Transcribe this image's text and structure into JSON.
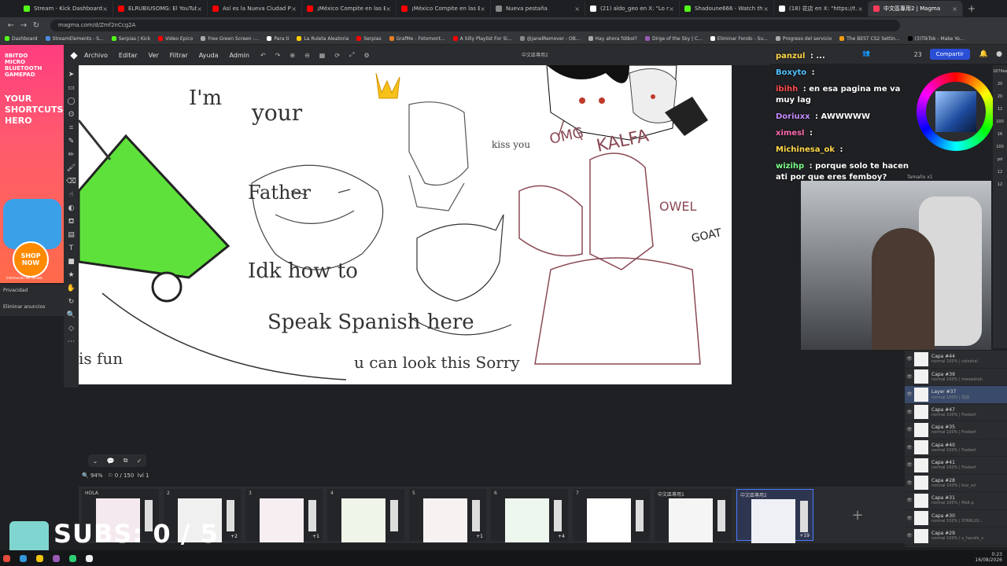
{
  "browser": {
    "tabs": [
      {
        "title": "Stream - Kick Dashboard",
        "color": "#53fc18"
      },
      {
        "title": "ELRUBIUSOMG: El YouTuber C",
        "color": "#ff0000"
      },
      {
        "title": "Así es la Nueva Ciudad Privad",
        "color": "#ff0000"
      },
      {
        "title": "¡México Compite en las Escon",
        "color": "#ff0000"
      },
      {
        "title": "¡México Compite en las Escon",
        "color": "#ff0000"
      },
      {
        "title": "Nueva pestaña",
        "color": "#888888"
      },
      {
        "title": "(21) aldo_geo en X: \"Lo recon",
        "color": "#ffffff"
      },
      {
        "title": "Shadoune666 - Watch the VO",
        "color": "#53fc18"
      },
      {
        "title": "(18) 花店 en X: \"https://t.co",
        "color": "#ffffff"
      },
      {
        "title": "中文區專用2 | Magma",
        "color": "#ff3b5c",
        "active": true
      }
    ],
    "url": "magma.com/d/Zmf2nCcg2A",
    "bookmarks": [
      "Dashboard",
      "StreamElements - S...",
      "Serpias | Kick",
      "Video Epico",
      "Free Green Screen -...",
      "Para ti",
      "La Ruleta Aleatoria",
      "Serpias",
      "GrafMe - Fotomont...",
      "A Silly Playlist For Si...",
      "@janelRemover - OB...",
      "Hay ahora fútbol?",
      "Dirge of the Sky | C...",
      "Eliminar Fondo - Su...",
      "Progreso del servicio",
      "The BEST CS2 Settin...",
      "(3)TikTok - Make Yo..."
    ]
  },
  "ad": {
    "line1": "8BITDO\nMICRO\nBLUETOOTH\nGAMEPAD",
    "line2": "YOUR\nSHORTCUTS\nHERO",
    "shop": "SHOP\nNOW",
    "info": "Información de afiliado"
  },
  "privacy": {
    "title": "Privacidad",
    "remove": "Eliminar anuncios"
  },
  "app": {
    "menus": [
      "Archivo",
      "Editar",
      "Ver",
      "Filtrar",
      "Ayuda",
      "Admin"
    ],
    "doc_title": "中文區專用2",
    "share": "Compartir",
    "online_count": "23",
    "zoom": "94%",
    "page_info": "0 / 150",
    "level": "lvl 1"
  },
  "canvas_text": [
    "I'm",
    "your",
    "Father",
    "Idk how to",
    "Speak Spanish here",
    "u can look this Sorry",
    "is fun",
    "kiss you",
    "OMG",
    "KALFA",
    "OWEL",
    "GOAT"
  ],
  "pages": [
    {
      "label": "HOLA",
      "badge": ""
    },
    {
      "label": "2",
      "badge": "+2"
    },
    {
      "label": "3",
      "badge": "+1"
    },
    {
      "label": "4",
      "badge": ""
    },
    {
      "label": "5",
      "badge": "+1"
    },
    {
      "label": "6",
      "badge": "+4"
    },
    {
      "label": "7",
      "badge": ""
    },
    {
      "label": "中文區專用1",
      "badge": ""
    },
    {
      "label": "中文區專用2",
      "badge": "+19",
      "active": true
    }
  ],
  "chat": [
    {
      "user": "panzul",
      "text": "..."
    },
    {
      "user": "Boxyto",
      "text": "",
      "color": "#4fc3ff"
    },
    {
      "user": "ibihh",
      "text": "en esa pagina me va muy lag",
      "color": "#ff4b4b"
    },
    {
      "user": "Doriuxx",
      "text": "AWWWWW",
      "color": "#c58bff"
    },
    {
      "user": "ximesl",
      "text": "",
      "color": "#ff6bb0"
    },
    {
      "user": "Michinesa_ok",
      "text": "",
      "color": "#ffd84a"
    },
    {
      "user": "wizihp",
      "text": "porque solo te hacen ati por que eres femboy?",
      "color": "#7dff8a"
    }
  ],
  "brush_size_label": "Tamaño x1",
  "right_values": [
    "1679ea",
    "20",
    "20",
    "12",
    "100",
    "16",
    "100",
    "pd",
    "12",
    "12"
  ],
  "layers": [
    {
      "name": "Capa #44",
      "sub": "normal 100% | celestial"
    },
    {
      "name": "Capa #39",
      "sub": "normal 100% | meowdrah"
    },
    {
      "name": "Layer #37",
      "sub": "normal 100% | 花店",
      "selected": true
    },
    {
      "name": "Capa #47",
      "sub": "normal 100% | Foxbert"
    },
    {
      "name": "Capa #35",
      "sub": "normal 100% | Foxbert"
    },
    {
      "name": "Capa #40",
      "sub": "normal 100% | Foxbert"
    },
    {
      "name": "Capa #41",
      "sub": "normal 100% | Foxbert"
    },
    {
      "name": "Capa #28",
      "sub": "normal 100% | kuo_xd"
    },
    {
      "name": "Capa #31",
      "sub": "normal 100% | Melt.p"
    },
    {
      "name": "Capa #30",
      "sub": "normal 100% | STARLUX..."
    },
    {
      "name": "Capa #29",
      "sub": "normal 100% | x_hacafa_x"
    }
  ],
  "overlay": {
    "subs": "SUBS: 0 / 5"
  },
  "clock": {
    "time": "0:23",
    "date": "16/08/2026"
  }
}
